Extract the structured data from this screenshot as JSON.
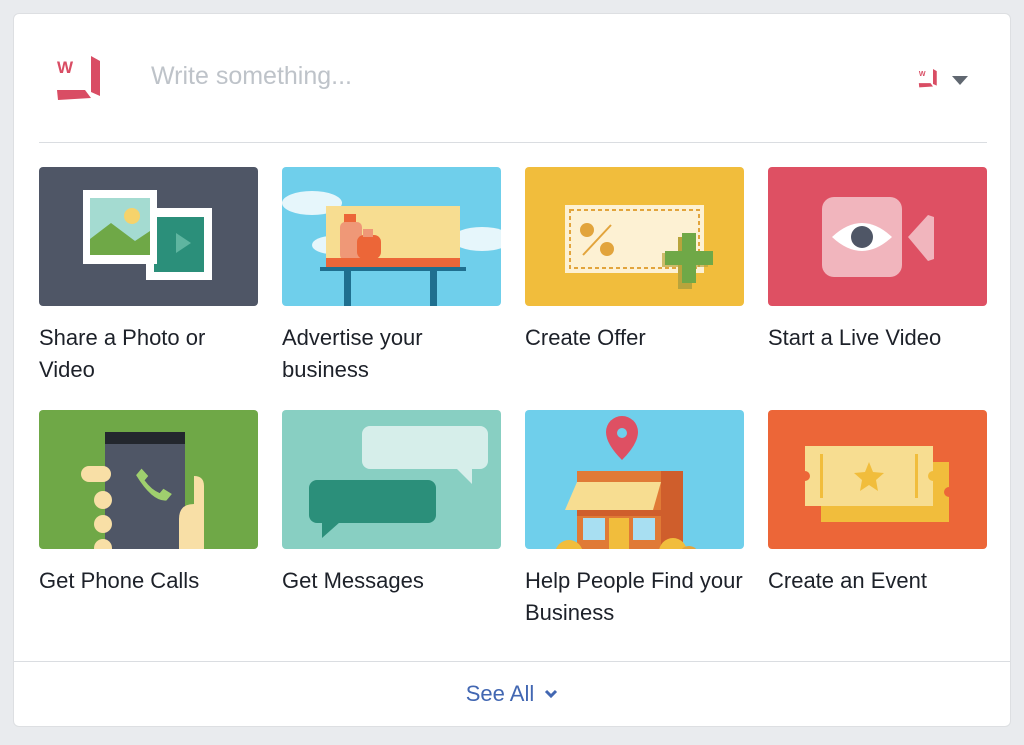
{
  "composer": {
    "placeholder": "Write something...",
    "page_logo_letter": "W",
    "brand_color": "#d94d64",
    "identity_selector_icon": "caret-down-icon"
  },
  "actions": [
    {
      "id": "share-photo-video",
      "label": "Share a Photo or Video",
      "icon": "photo-video-illustration",
      "bg": "#4f5666"
    },
    {
      "id": "advertise-business",
      "label": "Advertise your business",
      "icon": "billboard-illustration",
      "bg": "#6fcfeb"
    },
    {
      "id": "create-offer",
      "label": "Create Offer",
      "icon": "coupon-plus-illustration",
      "bg": "#f1bd3c"
    },
    {
      "id": "start-live-video",
      "label": "Start a Live Video",
      "icon": "live-video-eye-illustration",
      "bg": "#de5063"
    },
    {
      "id": "get-phone-calls",
      "label": "Get Phone Calls",
      "icon": "phone-call-illustration",
      "bg": "#6fa847"
    },
    {
      "id": "get-messages",
      "label": "Get Messages",
      "icon": "chat-bubbles-illustration",
      "bg": "#88cfc2"
    },
    {
      "id": "help-find-business",
      "label": "Help People Find your Business",
      "icon": "storefront-pin-illustration",
      "bg": "#6fcfeb"
    },
    {
      "id": "create-event",
      "label": "Create an Event",
      "icon": "event-ticket-illustration",
      "bg": "#ec6638"
    }
  ],
  "footer": {
    "see_all_label": "See All",
    "link_color": "#4267b2"
  }
}
